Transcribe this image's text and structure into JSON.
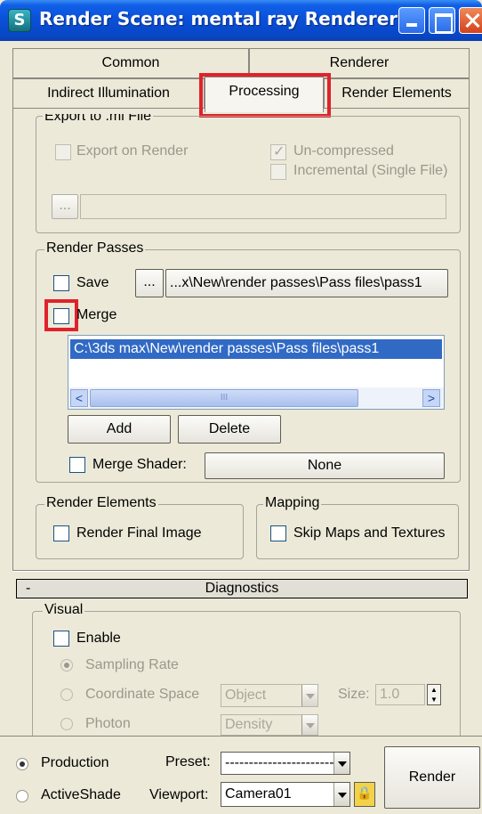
{
  "window": {
    "title": "Render Scene: mental ray Renderer",
    "icon_glyph": "S"
  },
  "tabs": {
    "common": "Common",
    "renderer": "Renderer",
    "indirect": "Indirect Illumination",
    "processing": "Processing",
    "render_elements": "Render Elements",
    "active": "Processing"
  },
  "export_mi": {
    "title": "Export to .mi File",
    "export_on_render": "Export on Render",
    "uncompressed": "Un-compressed",
    "incremental": "Incremental (Single File)",
    "browse": "...",
    "path": ""
  },
  "render_passes": {
    "title": "Render Passes",
    "save_label": "Save",
    "browse": "...",
    "save_path": "...x\\New\\render passes\\Pass files\\pass1",
    "merge_label": "Merge",
    "list_items": [
      "C:\\3ds max\\New\\render passes\\Pass files\\pass1"
    ],
    "scroll_grip": "III",
    "add": "Add",
    "delete": "Delete",
    "merge_shader_label": "Merge Shader:",
    "merge_shader_value": "None"
  },
  "render_elements_group": {
    "title": "Render Elements",
    "render_final_image": "Render Final Image"
  },
  "mapping_group": {
    "title": "Mapping",
    "skip_maps": "Skip Maps and Textures"
  },
  "diagnostics": {
    "collapse_glyph": "-",
    "title": "Diagnostics",
    "visual_title": "Visual",
    "enable": "Enable",
    "sampling_rate": "Sampling Rate",
    "coordinate_space": "Coordinate Space",
    "coordinate_value": "Object",
    "size_label": "Size:",
    "size_value": "1.0",
    "photon": "Photon",
    "photon_value": "Density"
  },
  "bottom": {
    "production": "Production",
    "activeshade": "ActiveShade",
    "preset_label": "Preset:",
    "preset_value": "-----------------------------",
    "viewport_label": "Viewport:",
    "viewport_value": "Camera01",
    "render": "Render"
  },
  "colors": {
    "highlight_red": "#e0222b",
    "selection_blue": "#316ac5",
    "title_blue": "#0a4fd8"
  }
}
